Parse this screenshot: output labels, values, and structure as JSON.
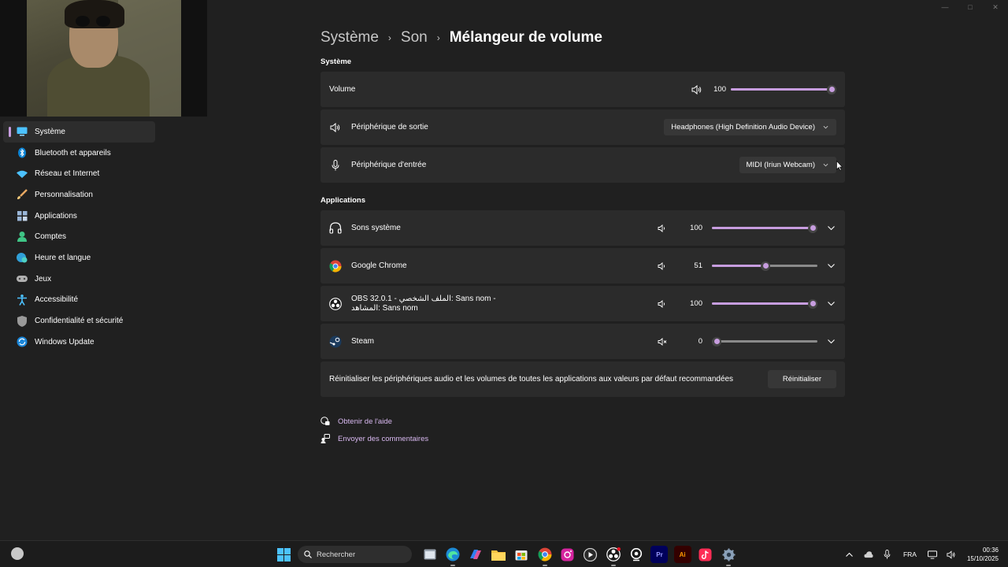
{
  "window": {
    "controls": [
      "minimize",
      "maximize",
      "close"
    ]
  },
  "sidebar": {
    "items": [
      {
        "label": "Système",
        "icon": "monitor-icon",
        "active": true
      },
      {
        "label": "Bluetooth et appareils",
        "icon": "bluetooth-icon"
      },
      {
        "label": "Réseau et Internet",
        "icon": "wifi-icon"
      },
      {
        "label": "Personnalisation",
        "icon": "brush-icon"
      },
      {
        "label": "Applications",
        "icon": "apps-icon"
      },
      {
        "label": "Comptes",
        "icon": "person-icon"
      },
      {
        "label": "Heure et langue",
        "icon": "globe-clock-icon"
      },
      {
        "label": "Jeux",
        "icon": "gamepad-icon"
      },
      {
        "label": "Accessibilité",
        "icon": "accessibility-icon"
      },
      {
        "label": "Confidentialité et sécurité",
        "icon": "shield-icon"
      },
      {
        "label": "Windows Update",
        "icon": "update-icon"
      }
    ]
  },
  "breadcrumb": {
    "level1": "Système",
    "level2": "Son",
    "current": "Mélangeur de volume",
    "separator": "›"
  },
  "system_section": {
    "title": "Système",
    "volume_label": "Volume",
    "volume_value": "100",
    "volume_level": 100,
    "output_label": "Périphérique de sortie",
    "output_device": "Headphones (High Definition Audio Device)",
    "input_label": "Périphérique d'entrée",
    "input_device": "MIDI (Iriun Webcam)"
  },
  "applications_section": {
    "title": "Applications",
    "apps": [
      {
        "name": "Sons système",
        "icon": "headphones-icon",
        "volume": "100",
        "level": 100,
        "muted": false
      },
      {
        "name": "Google Chrome",
        "icon": "chrome-icon",
        "volume": "51",
        "level": 51,
        "muted": false
      },
      {
        "name": "OBS 32.0.1 - الملف الشخصي: Sans nom -",
        "name_line2": "المشاهد: Sans nom",
        "icon": "obs-icon",
        "volume": "100",
        "level": 100,
        "muted": false
      },
      {
        "name": "Steam",
        "icon": "steam-icon",
        "volume": "0",
        "level": 0,
        "muted": true
      }
    ]
  },
  "reset": {
    "text": "Réinitialiser les périphériques audio et les volumes de toutes les applications aux valeurs par défaut recommandées",
    "button": "Réinitialiser"
  },
  "links": {
    "help": "Obtenir de l'aide",
    "feedback": "Envoyer des commentaires"
  },
  "taskbar": {
    "search_placeholder": "Rechercher",
    "apps": [
      "file-explorer-window-icon",
      "edge-icon",
      "copilot-icon",
      "folder-icon",
      "store-icon",
      "chrome-icon",
      "instagram-icon",
      "media-player-icon",
      "obs-icon",
      "webcam-icon",
      "premiere-icon",
      "illustrator-icon",
      "tiktok-icon",
      "settings-icon"
    ],
    "premiere_label": "Pr",
    "illustrator_label": "Ai",
    "language": "FRA",
    "time": "00:36",
    "date": "15/10/2025"
  },
  "colors": {
    "accent": "#c79ddf",
    "background": "#202020",
    "card": "#2b2b2b"
  }
}
